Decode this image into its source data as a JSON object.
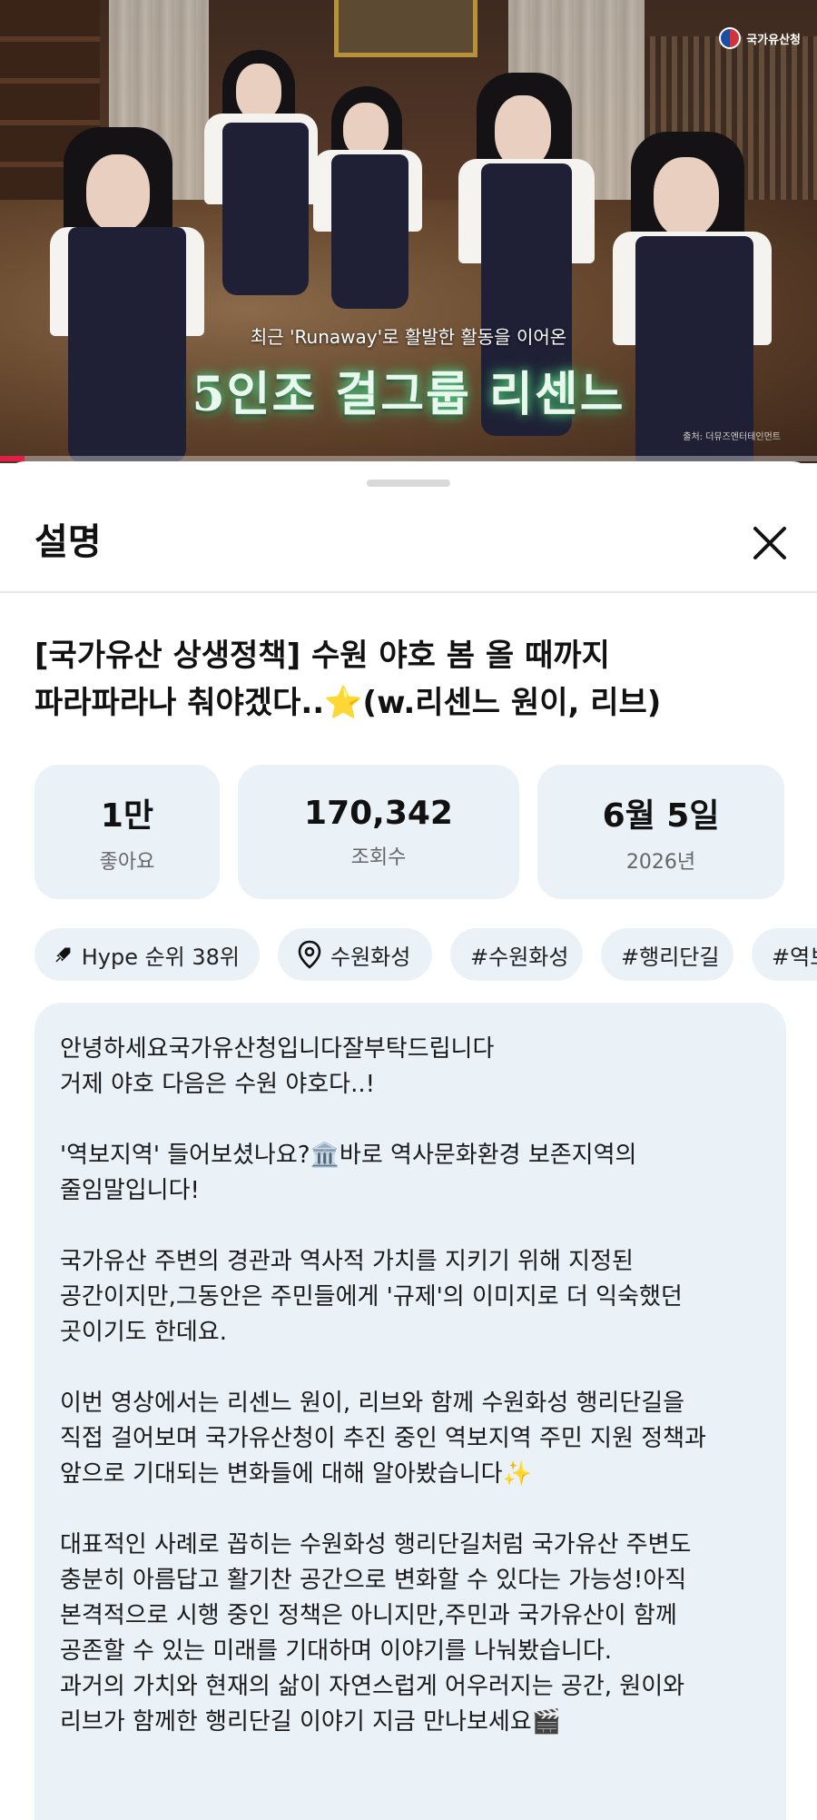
{
  "video": {
    "logo_text": "국가유산청",
    "caption_small": "최근 'Runaway'로 활발한 활동을 이어온",
    "caption_big": "5인조 걸그룹 리센느",
    "credit": "출처: 더뮤즈엔터테인먼트",
    "progress": 0.03,
    "colors": {
      "progress": "#e11d48",
      "caption_glow": "#5fd08a"
    }
  },
  "sheet": {
    "title": "설명",
    "close_icon": "close-icon",
    "video_title_line1": "[국가유산 상생정책] 수원 야호 봄 올 때까지",
    "video_title_line2_pre": "파라파라나 춰야겠다..",
    "video_title_emoji": "⭐",
    "video_title_line2_post": "(w.리센느 원이, 리브)",
    "stats": [
      {
        "value": "1만",
        "label": "좋아요"
      },
      {
        "value": "170,342",
        "label": "조회수"
      },
      {
        "value": "6월 5일",
        "label": "2026년"
      }
    ],
    "chips": [
      {
        "icon": "rocket-icon",
        "label": "Hype 순위 38위"
      },
      {
        "icon": "location-pin-icon",
        "label": "수원화성"
      },
      {
        "label": "#수원화성"
      },
      {
        "label": "#행리단길"
      },
      {
        "label": "#역보지역"
      }
    ],
    "description": "안녕하세요국가유산청입니다잘부탁드립니다\n거제 야호 다음은 수원 야호다..!\n\n'역보지역' 들어보셨나요?🏛️바로 역사문화환경 보존지역의\n줄임말입니다!\n\n국가유산 주변의 경관과 역사적 가치를 지키기 위해 지정된\n공간이지만,그동안은 주민들에게 '규제'의 이미지로 더 익숙했던\n곳이기도 한데요.\n\n이번 영상에서는 리센느 원이, 리브와 함께 수원화성 행리단길을\n직접 걸어보며 국가유산청이 추진 중인 역보지역 주민 지원 정책과\n앞으로 기대되는 변화들에 대해 알아봤습니다✨\n\n대표적인 사례로 꼽히는 수원화성 행리단길처럼 국가유산 주변도\n충분히 아름답고 활기찬 공간으로 변화할 수 있다는 가능성!아직\n본격적으로 시행 중인 정책은 아니지만,주민과 국가유산이 함께\n공존할 수 있는 미래를 기대하며 이야기를 나눠봤습니다.\n과거의 가치와 현재의 삶이 자연스럽게 어우러지는 공간, 원이와\n리브가 함께한 행리단길 이야기 지금 만나보세요🎬"
  }
}
